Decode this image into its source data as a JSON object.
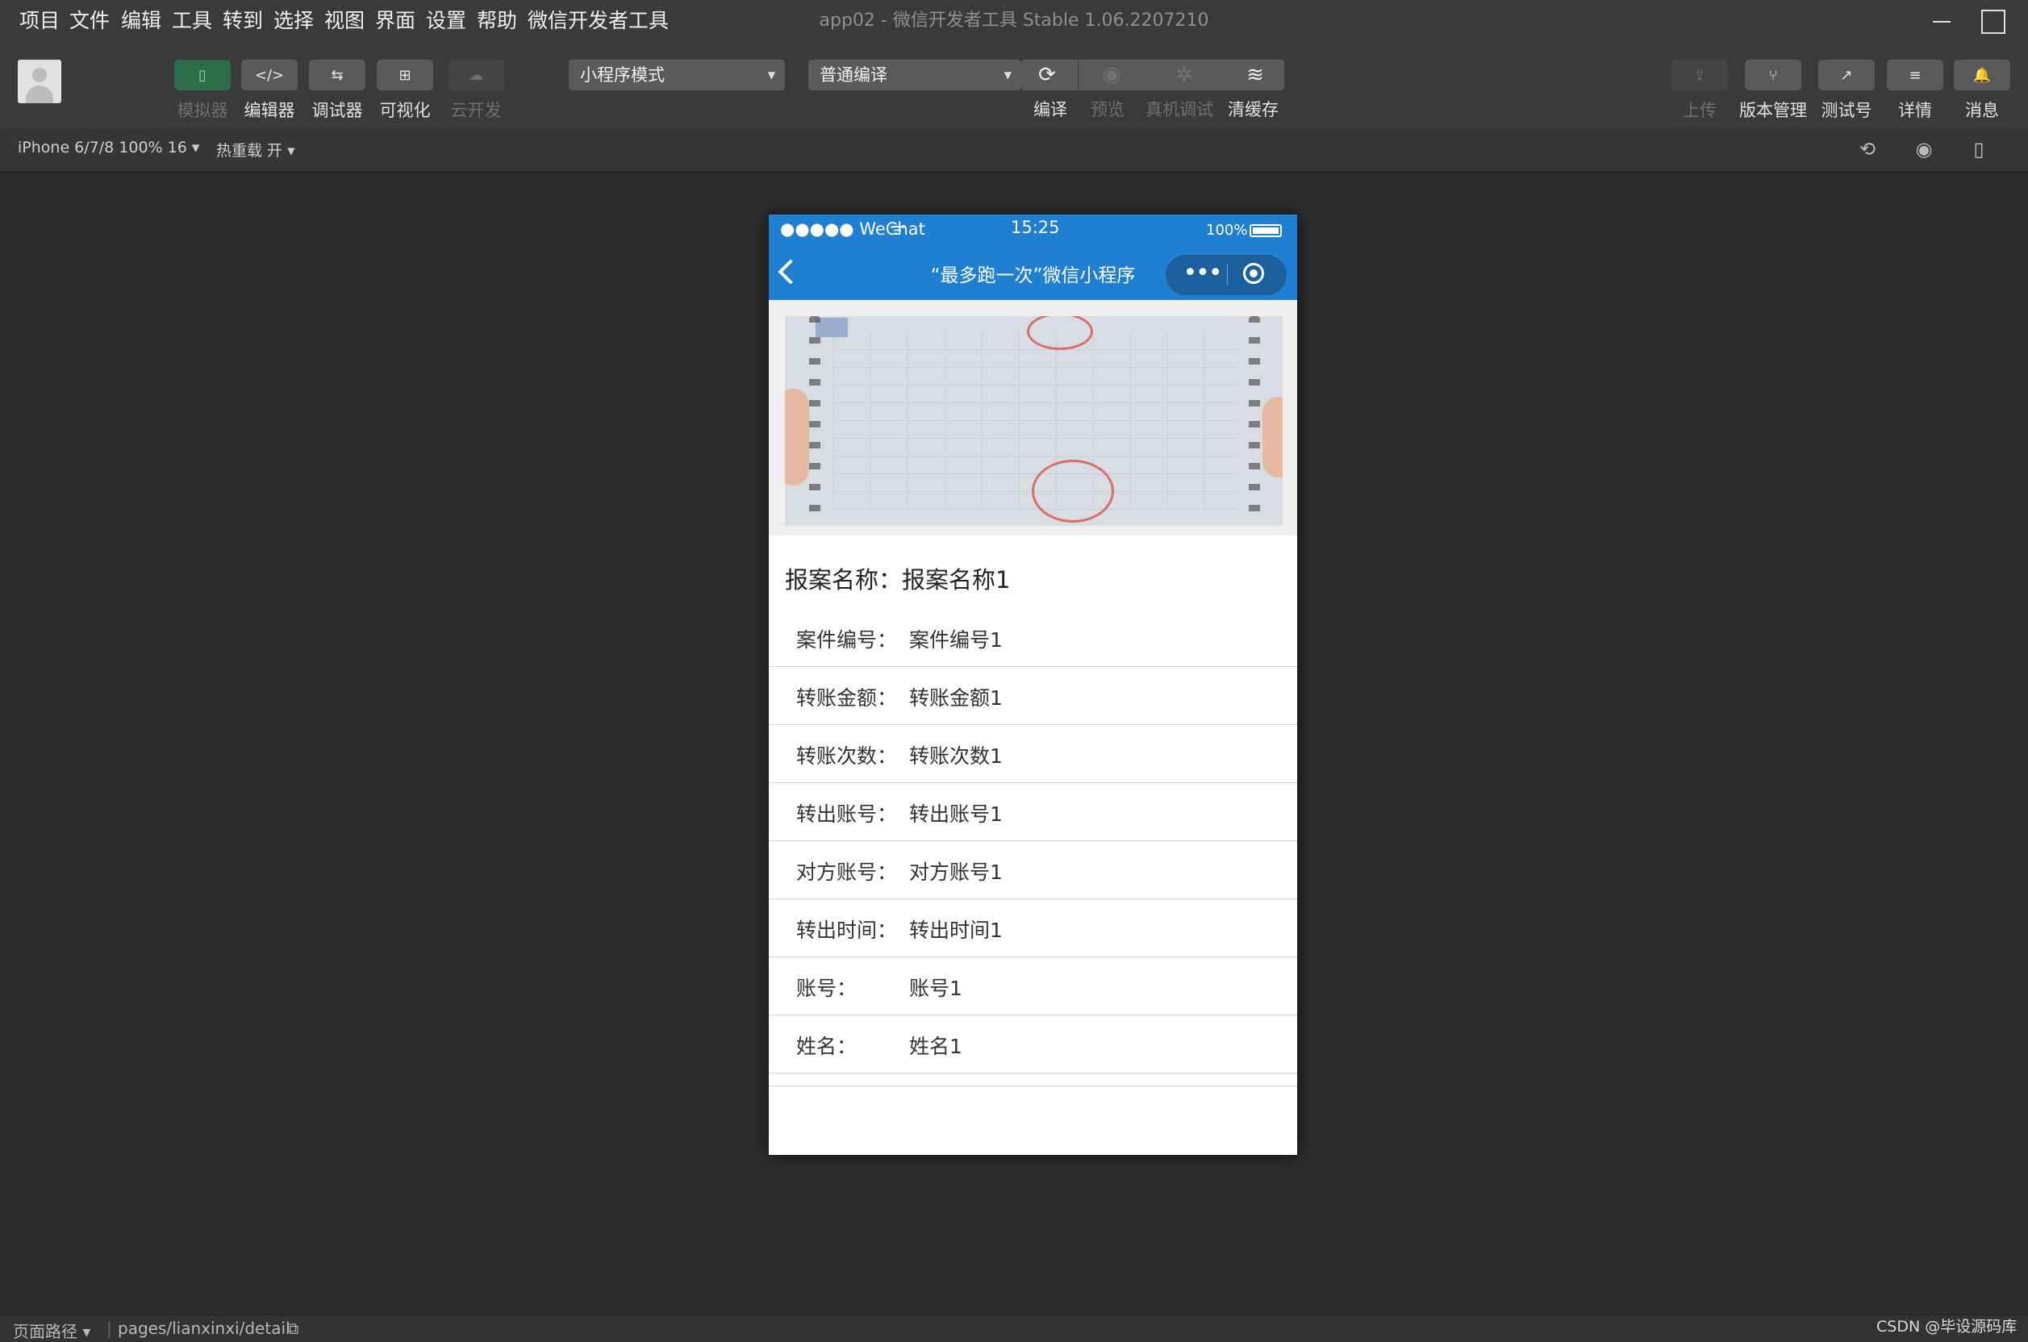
{
  "menu": [
    "项目",
    "文件",
    "编辑",
    "工具",
    "转到",
    "选择",
    "视图",
    "界面",
    "设置",
    "帮助",
    "微信开发者工具"
  ],
  "window_title": "app02 - 微信开发者工具 Stable 1.06.2207210",
  "toolbar": {
    "views": [
      {
        "label": "模拟器",
        "icon": "phone-icon",
        "glyph": "▯",
        "state": "active"
      },
      {
        "label": "编辑器",
        "icon": "code-icon",
        "glyph": "</>",
        "state": "normal"
      },
      {
        "label": "调试器",
        "icon": "debugger-icon",
        "glyph": "⇆",
        "state": "normal"
      },
      {
        "label": "可视化",
        "icon": "layout-icon",
        "glyph": "⊞",
        "state": "normal"
      },
      {
        "label": "云开发",
        "icon": "cloud-icon",
        "glyph": "☁",
        "state": "disabled"
      }
    ],
    "mode_select": "小程序模式",
    "compile_select": "普通编译",
    "actions": [
      {
        "label": "编译",
        "icon": "refresh-icon",
        "glyph": "⟳",
        "state": "normal"
      },
      {
        "label": "预览",
        "icon": "eye-icon",
        "glyph": "◉",
        "state": "disabled"
      },
      {
        "label": "真机调试",
        "icon": "bug-icon",
        "glyph": "✲",
        "state": "disabled"
      },
      {
        "label": "清缓存",
        "icon": "layers-icon",
        "glyph": "≋",
        "state": "normal"
      }
    ],
    "right_tools": [
      {
        "label": "上传",
        "icon": "upload-icon",
        "glyph": "⇪",
        "state": "disabled"
      },
      {
        "label": "版本管理",
        "icon": "branch-icon",
        "glyph": "⑂",
        "state": "normal"
      },
      {
        "label": "测试号",
        "icon": "external-link-icon",
        "glyph": "↗",
        "state": "normal"
      },
      {
        "label": "详情",
        "icon": "menu-icon",
        "glyph": "≡",
        "state": "normal"
      },
      {
        "label": "消息",
        "icon": "bell-icon",
        "glyph": "🔔",
        "state": "normal"
      }
    ]
  },
  "subbar": {
    "device": "iPhone 6/7/8 100% 16 ▾",
    "hot_reload": "热重载 开 ▾"
  },
  "phone": {
    "status": {
      "signal": "●●●●● WeChat",
      "wifi": "ᯤ",
      "time": "15:25",
      "battery": "100%"
    },
    "nav_title": "“最多跑一次”微信小程序",
    "case_name_label": "报案名称：",
    "case_name_value": "报案名称1",
    "rows": [
      {
        "label": "案件编号：",
        "value": "案件编号1"
      },
      {
        "label": "转账金额：",
        "value": "转账金额1"
      },
      {
        "label": "转账次数：",
        "value": "转账次数1"
      },
      {
        "label": "转出账号：",
        "value": "转出账号1"
      },
      {
        "label": "对方账号：",
        "value": "对方账号1"
      },
      {
        "label": "转出时间：",
        "value": "转出时间1"
      },
      {
        "label": "账号：",
        "value": "账号1"
      },
      {
        "label": "姓名：",
        "value": "姓名1"
      }
    ]
  },
  "bottom": {
    "path_label": "页面路径 ▾",
    "path_value": "pages/lianxinxi/detail"
  },
  "watermark": "CSDN @毕设源码库",
  "colors": {
    "accent": "#1f7fd1",
    "active_tool": "#2e6d4a",
    "bg": "#2b2b2b"
  }
}
